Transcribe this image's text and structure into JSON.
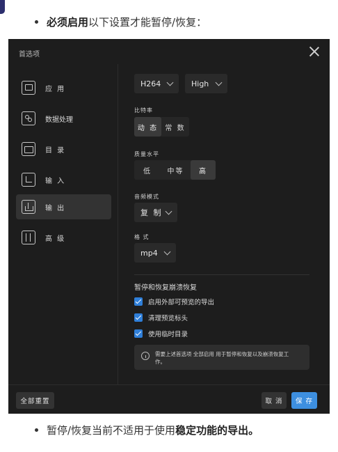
{
  "doc": {
    "bullet1": {
      "bold": "必须启用",
      "rest": "以下设置才能暂停/恢复："
    },
    "bullet2": {
      "prefix": "暂停/恢复当前不适用于使用",
      "bold": "稳定功能的导出。"
    }
  },
  "dialog": {
    "title": "首选项",
    "sidebar": [
      {
        "label": "应 用",
        "icon": "monitor-icon"
      },
      {
        "label": "数据处理",
        "icon": "data-processing-icon"
      },
      {
        "label": "目 录",
        "icon": "folder-icon"
      },
      {
        "label": "输 入",
        "icon": "import-arrow-icon"
      },
      {
        "label": "输 出",
        "icon": "export-icon"
      },
      {
        "label": "高 级",
        "icon": "advanced-sliders-icon"
      }
    ],
    "active_item": "输 出",
    "codec": "H264",
    "profile": "High",
    "bitrate": {
      "label": "比特率",
      "options": [
        "动 态",
        "常 数"
      ],
      "selected": "动 态"
    },
    "quality": {
      "label": "质量水平",
      "options": [
        "低",
        "中等",
        "高"
      ],
      "selected": "高"
    },
    "audio": {
      "label": "音频模式",
      "value": "复 制"
    },
    "format": {
      "label": "格 式",
      "value": "mp4"
    },
    "pause_section": {
      "title": "暂停和恢复崩溃恢复",
      "checks": [
        {
          "label": "启用外部可预览的导出",
          "checked": true
        },
        {
          "label": "清理预览标头",
          "checked": true
        },
        {
          "label": "使用临时目录",
          "checked": true
        }
      ],
      "info_line1": "需要上述首选项 全部启用 用于暂停和恢复以及崩溃恢复工",
      "info_line2": "作。"
    },
    "footer": {
      "reset": "全部重置",
      "cancel": "取 消",
      "save": "保 存"
    }
  }
}
